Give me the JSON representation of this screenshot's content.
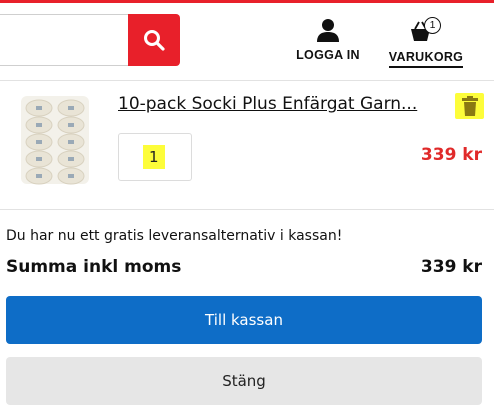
{
  "header": {
    "search_value": "",
    "search_icon": "search-icon",
    "login_label": "LOGGA IN",
    "login_icon": "user-icon",
    "cart_label": "VARUKORG",
    "cart_icon": "basket-icon",
    "cart_count": "1"
  },
  "cart_item": {
    "title": "10-pack Socki Plus Enfärgat Garn...",
    "quantity": "1",
    "price": "339 kr",
    "thumbnail_icon": "yarn-pack-image",
    "delete_icon": "trash-icon"
  },
  "summary": {
    "notice": "Du har nu ett gratis leveransalternativ i kassan!",
    "total_label": "Summa inkl moms",
    "total_value": "339 kr"
  },
  "actions": {
    "checkout_label": "Till kassan",
    "close_label": "Stäng"
  },
  "colors": {
    "brand_red": "#e8202a",
    "price_red": "#e02a2a",
    "primary_blue": "#0e6dc7",
    "secondary_gray": "#e6e6e6",
    "highlight_yellow": "#fdfd3a"
  }
}
